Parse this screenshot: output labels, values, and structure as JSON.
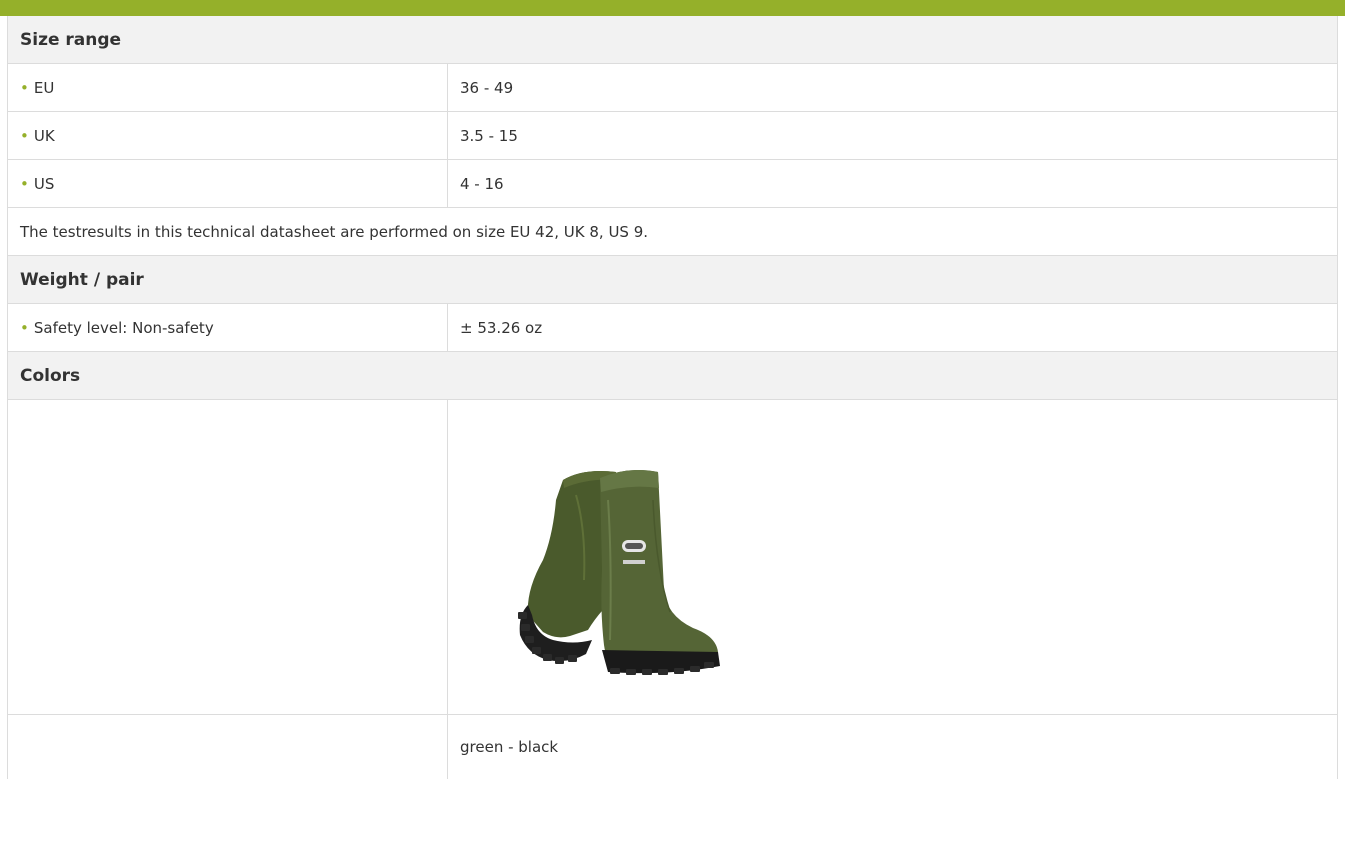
{
  "colors": {
    "accent": "#95b02a",
    "header_bg": "#f2f2f2",
    "border": "#dcdcdc"
  },
  "size_range": {
    "title": "Size range",
    "rows": [
      {
        "label": "EU",
        "value": "36 - 49"
      },
      {
        "label": "UK",
        "value": "3.5 - 15"
      },
      {
        "label": "US",
        "value": "4 - 16"
      }
    ],
    "note": "The testresults in this technical datasheet are performed on size EU 42, UK 8, US 9."
  },
  "weight": {
    "title": "Weight / pair",
    "rows": [
      {
        "label": "Safety level: Non-safety",
        "value": "± 53.26 oz"
      }
    ]
  },
  "colors_section": {
    "title": "Colors",
    "image_icon": "boot-pair-image",
    "color_name": "green - black"
  }
}
